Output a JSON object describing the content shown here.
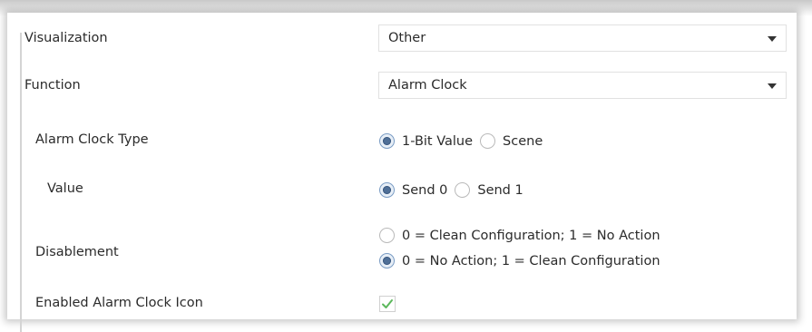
{
  "rows": {
    "visualization": {
      "label": "Visualization",
      "value": "Other"
    },
    "function": {
      "label": "Function",
      "value": "Alarm Clock"
    },
    "alarm_clock_type": {
      "label": "Alarm Clock Type",
      "options": [
        "1-Bit Value",
        "Scene"
      ],
      "selected": "1-Bit Value"
    },
    "value": {
      "label": "Value",
      "options": [
        "Send 0",
        "Send 1"
      ],
      "selected": "Send 0"
    },
    "disablement": {
      "label": "Disablement",
      "options": [
        "0 = Clean Configuration; 1 = No Action",
        "0 = No Action; 1 = Clean Configuration"
      ],
      "selected": "0 = No Action; 1 = Clean Configuration"
    },
    "enabled_icon": {
      "label": "Enabled Alarm Clock Icon",
      "checked": true
    }
  },
  "icons": {
    "dropdown": "chevron-down-icon",
    "check": "checkmark-icon"
  },
  "colors": {
    "radio_selected": "#4f6f97",
    "check": "#5cb85c"
  }
}
